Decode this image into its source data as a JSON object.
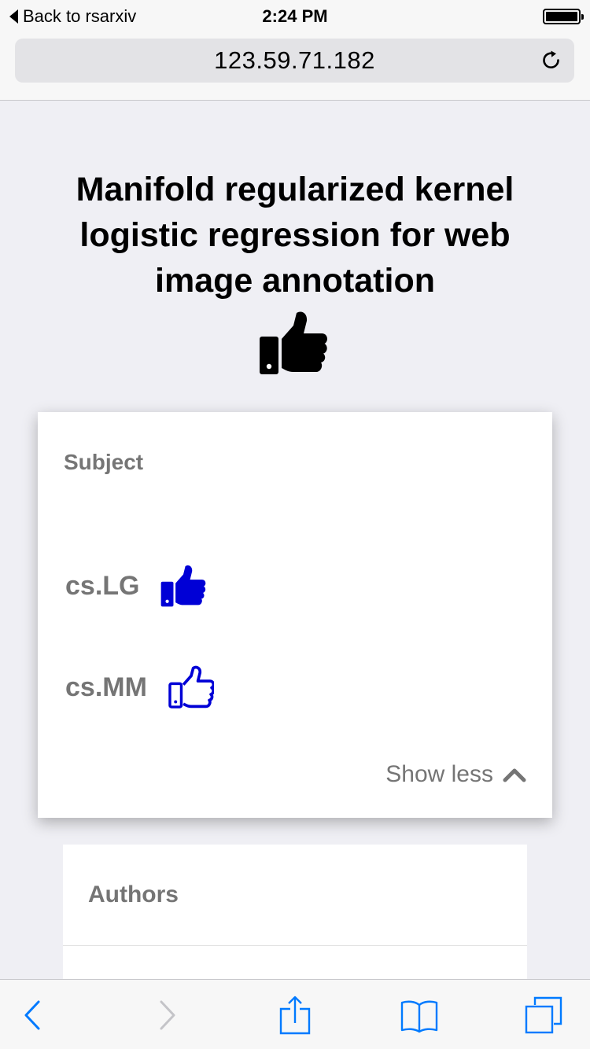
{
  "status_bar": {
    "back_label": "Back to rsarxiv",
    "time": "2:24 PM",
    "battery_level": 1.0
  },
  "browser": {
    "url": "123.59.71.182"
  },
  "paper": {
    "title": "Manifold regularized kernel logistic regression for web image annotation",
    "title_icon": "thumbs-up-icon"
  },
  "subject_card": {
    "heading": "Subject",
    "subjects": [
      {
        "label": "cs.LG",
        "icon": "thumbs-up-filled-icon"
      },
      {
        "label": "cs.MM",
        "icon": "thumbs-up-outline-icon"
      }
    ],
    "toggle_label": "Show less",
    "toggle_icon": "chevron-up-icon"
  },
  "authors_card": {
    "heading": "Authors"
  },
  "toolbar": {
    "items": [
      "back-icon",
      "forward-icon",
      "share-icon",
      "bookmarks-icon",
      "tabs-icon"
    ]
  },
  "colors": {
    "accent_blue": "#0000d6",
    "ios_blue": "#007aff",
    "gray_text": "#757575",
    "background": "#efeff4"
  }
}
